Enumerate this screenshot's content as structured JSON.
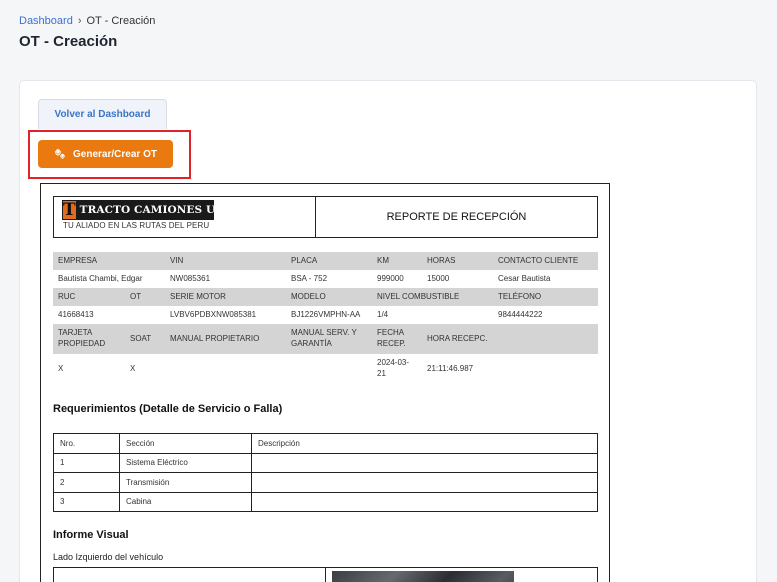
{
  "breadcrumb": {
    "root": "Dashboard",
    "current": "OT - Creación"
  },
  "page": {
    "title": "OT - Creación"
  },
  "actions": {
    "back_label": "Volver al Dashboard",
    "generate_label": "Generar/Crear OT"
  },
  "colors": {
    "primary_orange": "#ea7a10",
    "highlight_red": "#e0232b",
    "link_blue": "#3b6fd6"
  },
  "report": {
    "logo_text": "TRACTO CAMIONES USA",
    "logo_letter": "T",
    "slogan": "TU ALIADO EN LAS RUTAS DEL PERU",
    "title": "REPORTE DE RECEPCIÓN",
    "info": {
      "row1_headers": [
        "EMPRESA",
        "VIN",
        "PLACA",
        "KM",
        "HORAS",
        "CONTACTO CLIENTE"
      ],
      "row1_values": [
        "Bautista Chambi, Edgar",
        "NW085361",
        "BSA - 752",
        "999000",
        "15000",
        "Cesar Bautista"
      ],
      "row2_headers": [
        "RUC",
        "OT",
        "SERIE MOTOR",
        "MODELO",
        "NIVEL COMBUSTIBLE",
        "",
        "TELÉFONO"
      ],
      "row2_values": [
        "41668413",
        "",
        "LVBV6PDBXNW085381",
        "BJ1226VMPHN-AA",
        "1/4",
        "",
        "9844444222"
      ],
      "row3_headers": [
        "TARJETA PROPIEDAD",
        "SOAT",
        "MANUAL PROPIETARIO",
        "MANUAL SERV. Y GARANTÍA",
        "FECHA RECEP.",
        "HORA RECEPC.",
        ""
      ],
      "row3_values": [
        "X",
        "X",
        "",
        "",
        "2024-03-21",
        "21:11:46.987",
        ""
      ]
    },
    "requirements": {
      "title": "Requerimientos (Detalle de Servicio o Falla)",
      "headers": [
        "Nro.",
        "Sección",
        "Descripción"
      ],
      "rows": [
        [
          "1",
          "Sistema Eléctrico",
          ""
        ],
        [
          "2",
          "Transmisión",
          ""
        ],
        [
          "3",
          "Cabina",
          ""
        ]
      ]
    },
    "visual": {
      "title": "Informe Visual",
      "subtitle": "Lado Izquierdo del vehículo"
    }
  }
}
